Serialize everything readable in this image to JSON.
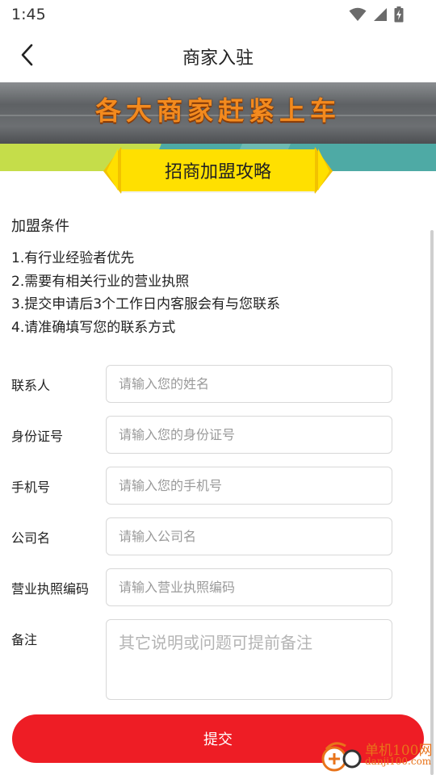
{
  "status_bar": {
    "time": "1:45",
    "icons": [
      "wifi-icon",
      "signal-icon",
      "battery-charging-icon"
    ]
  },
  "nav": {
    "back_icon": "chevron-left-icon",
    "title": "商家入驻"
  },
  "banner": {
    "slogan": "各大商家赶紧上车",
    "ribbon_text": "招商加盟攻略",
    "colors": {
      "slogan": "#f38a1e",
      "ribbon": "#ffe000",
      "stripe_left": "#c5dd4a",
      "stripe_right": "#4eaaa5"
    }
  },
  "conditions": {
    "title": "加盟条件",
    "items": [
      "1.有行业经验者优先",
      "2.需要有相关行业的营业执照",
      "3.提交申请后3个工作日内客服会有与您联系",
      "4.请准确填写您的联系方式"
    ]
  },
  "form": {
    "fields": [
      {
        "label": "联系人",
        "value": "",
        "placeholder": "请输入您的姓名"
      },
      {
        "label": "身份证号",
        "value": "",
        "placeholder": "请输入您的身份证号"
      },
      {
        "label": "手机号",
        "value": "",
        "placeholder": "请输入您的手机号"
      },
      {
        "label": "公司名",
        "value": "",
        "placeholder": "请输入公司名"
      },
      {
        "label": "营业执照编码",
        "value": "",
        "placeholder": "请输入营业执照编码"
      }
    ],
    "remark": {
      "label": "备注",
      "value": "",
      "placeholder": "其它说明或问题可提前备注"
    },
    "submit_label": "提交",
    "accent_color": "#ee1d25"
  },
  "watermark": {
    "text": "单机100网",
    "url": "danji100.com"
  }
}
